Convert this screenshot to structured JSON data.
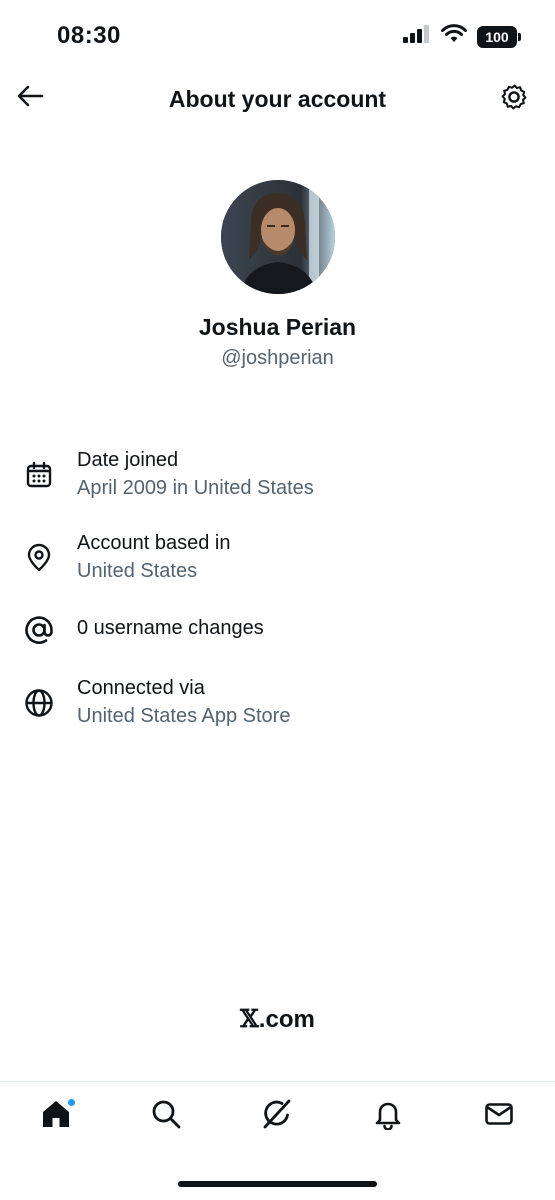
{
  "status_bar": {
    "time": "08:30",
    "battery": "100",
    "icons": [
      "signal-icon",
      "wifi-icon",
      "battery-icon"
    ]
  },
  "header": {
    "title": "About your account",
    "back_icon": "back-arrow-icon",
    "settings_icon": "gear-icon"
  },
  "profile": {
    "name": "Joshua Perian",
    "handle": "@joshperian"
  },
  "info": [
    {
      "icon": "calendar-icon",
      "title": "Date joined",
      "value": "April 2009 in United States"
    },
    {
      "icon": "location-pin-icon",
      "title": "Account based in",
      "value": "United States"
    },
    {
      "icon": "at-sign-icon",
      "title": "0 username changes"
    },
    {
      "icon": "globe-icon",
      "title": "Connected via",
      "value": "United States App Store"
    }
  ],
  "footer": {
    "logo_mark": "𝕏",
    "logo_text": ".com"
  },
  "tab_bar": {
    "tabs": [
      "home-icon",
      "search-icon",
      "grok-icon",
      "bell-icon",
      "mail-icon"
    ],
    "active": "home",
    "home_has_badge": true
  },
  "colors": {
    "text_primary": "#0f1419",
    "text_secondary": "#536471",
    "badge_blue": "#1d9bf0"
  }
}
